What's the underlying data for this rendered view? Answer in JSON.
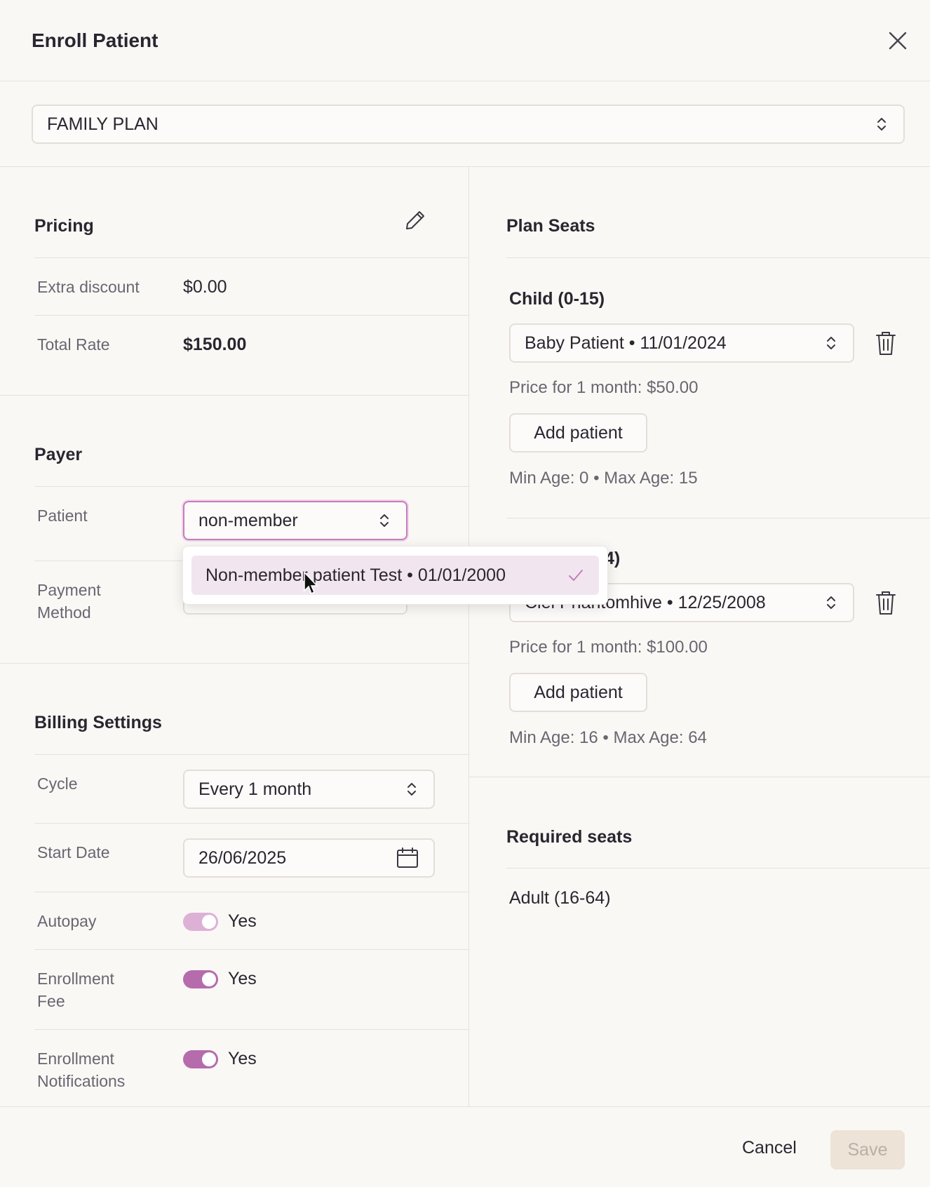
{
  "modal": {
    "title": "Enroll Patient"
  },
  "plan_select": {
    "value": "FAMILY PLAN"
  },
  "pricing": {
    "title": "Pricing",
    "rows": [
      {
        "label": "Extra discount",
        "value": "$0.00"
      },
      {
        "label": "Total Rate",
        "value": "$150.00"
      }
    ]
  },
  "payer": {
    "title": "Payer",
    "patient_label": "Patient",
    "patient_input_value": "non-member",
    "payment_label_line1": "Payment",
    "payment_label_line2": "Method",
    "dropdown_option": "Non-member patient Test • 01/01/2000"
  },
  "billing": {
    "title": "Billing Settings",
    "cycle_label": "Cycle",
    "cycle_value": "Every 1 month",
    "start_label": "Start Date",
    "start_value": "26/06/2025",
    "autopay_label": "Autopay",
    "autopay_value": "Yes",
    "enroll_fee_label_line1": "Enrollment",
    "enroll_fee_label_line2": "Fee",
    "enroll_fee_value": "Yes",
    "enroll_notif_label_line1": "Enrollment",
    "enroll_notif_label_line2": "Notifications",
    "enroll_notif_value": "Yes"
  },
  "seats": {
    "title": "Plan Seats",
    "groups": [
      {
        "title": "Child (0-15)",
        "patient": "Baby Patient • 11/01/2024",
        "price": "Price for 1 month: $50.00",
        "add_label": "Add patient",
        "ages": "Min Age: 0 • Max Age: 15"
      },
      {
        "title_visible_fragment": "4)",
        "patient": "Ciel Phantomhive • 12/25/2008",
        "price": "Price for 1 month: $100.00",
        "add_label": "Add patient",
        "ages": "Min Age: 16 • Max Age: 64"
      }
    ],
    "required_title": "Required seats",
    "required_items": [
      "Adult (16-64)"
    ]
  },
  "footer": {
    "cancel_label": "Cancel",
    "save_label": "Save"
  },
  "colors": {
    "accent": "#b66bac",
    "accent_light": "#ddb1d6",
    "save_bg": "#ede3d6",
    "save_text": "#b9afa6"
  }
}
